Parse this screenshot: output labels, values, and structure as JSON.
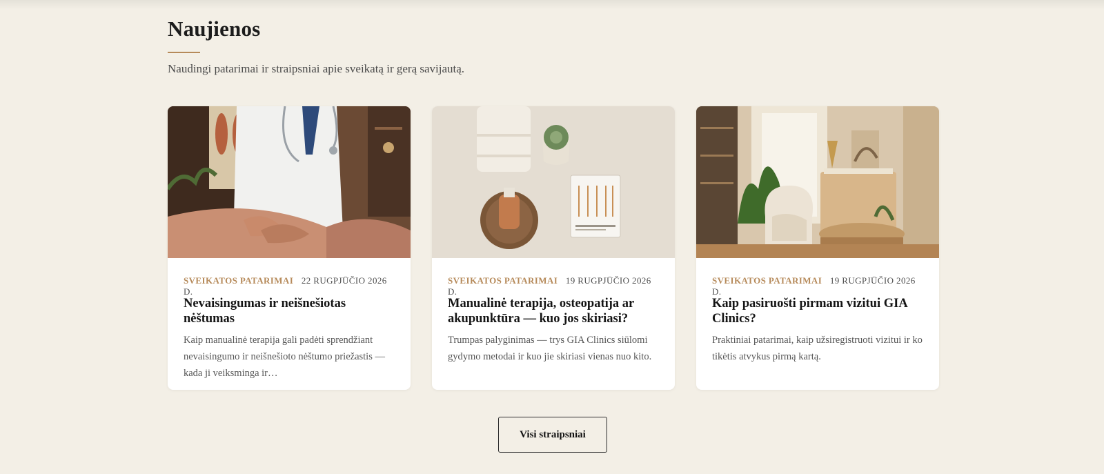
{
  "news": {
    "title": "Naujienos",
    "subtitle": "Naudingi patarimai ir straipsniai apie sveikatą ir gerą savijautą.",
    "articles": [
      {
        "category": "SVEIKATOS PATARIMAI",
        "date": "22 RUGPJŪČIO 2026 D.",
        "title": "Nevaisingumas ir neišnešiotas nėštumas",
        "excerpt": "Kaip manualinė terapija gali padėti sprendžiant nevaisingumo ir neišnešioto nėštumo priežastis — kada ji veiksminga ir…",
        "image": "massage-therapy-photo"
      },
      {
        "category": "SVEIKATOS PATARIMAI",
        "date": "19 RUGPJŪČIO 2026 D.",
        "title": "Manualinė terapija, osteopatija ar akupunktūra — kuo jos skiriasi?",
        "excerpt": "Trumpas palyginimas — trys GIA Clinics siūlomi gydymo metodai ir kuo jie skiriasi vienas nuo kito.",
        "image": "acupuncture-needles-photo"
      },
      {
        "category": "SVEIKATOS PATARIMAI",
        "date": "19 RUGPJŪČIO 2026 D.",
        "title": "Kaip pasiruošti pirmam vizitui GIA Clinics?",
        "excerpt": "Praktiniai patarimai, kaip užsiregistruoti vizitui ir ko tikėtis atvykus pirmą kartą.",
        "image": "clinic-reception-photo"
      }
    ],
    "all_button": "Visi straipsniai"
  },
  "colors": {
    "background": "#f3efe6",
    "accent": "#b68a5a",
    "card": "#ffffff"
  }
}
